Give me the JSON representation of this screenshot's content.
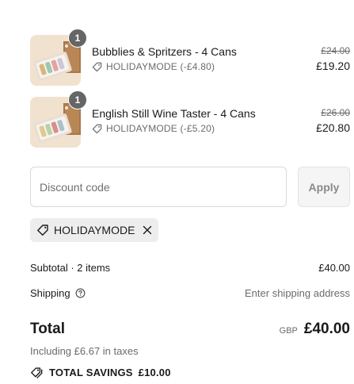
{
  "line_items": [
    {
      "quantity": "1",
      "title": "Bubblies & Spritzers - 4 Cans",
      "discount": "HOLIDAYMODE (-£4.80)",
      "original_price": "£24.00",
      "final_price": "£19.20"
    },
    {
      "quantity": "1",
      "title": "English Still Wine Taster - 4 Cans",
      "discount": "HOLIDAYMODE (-£5.20)",
      "original_price": "£26.00",
      "final_price": "£20.80"
    }
  ],
  "discount_form": {
    "placeholder": "Discount code",
    "value": "",
    "apply_label": "Apply"
  },
  "applied_code": {
    "code": "HOLIDAYMODE"
  },
  "summary": {
    "subtotal_label": "Subtotal · 2 items",
    "subtotal_value": "£40.00",
    "shipping_label": "Shipping",
    "shipping_value": "Enter shipping address"
  },
  "total": {
    "label": "Total",
    "currency": "GBP",
    "amount": "£40.00",
    "taxes_note": "Including £6.67 in taxes",
    "savings_label": "TOTAL SAVINGS",
    "savings_amount": "£10.00"
  },
  "icons": {
    "tag": "tag-icon",
    "close": "close-icon",
    "help": "help-circle-icon",
    "savings": "savings-tag-icon"
  },
  "colors": {
    "badge": "#666666",
    "muted_text": "#6b6b6b",
    "chip_bg": "#ededed",
    "apply_bg": "#f5f5f5"
  }
}
